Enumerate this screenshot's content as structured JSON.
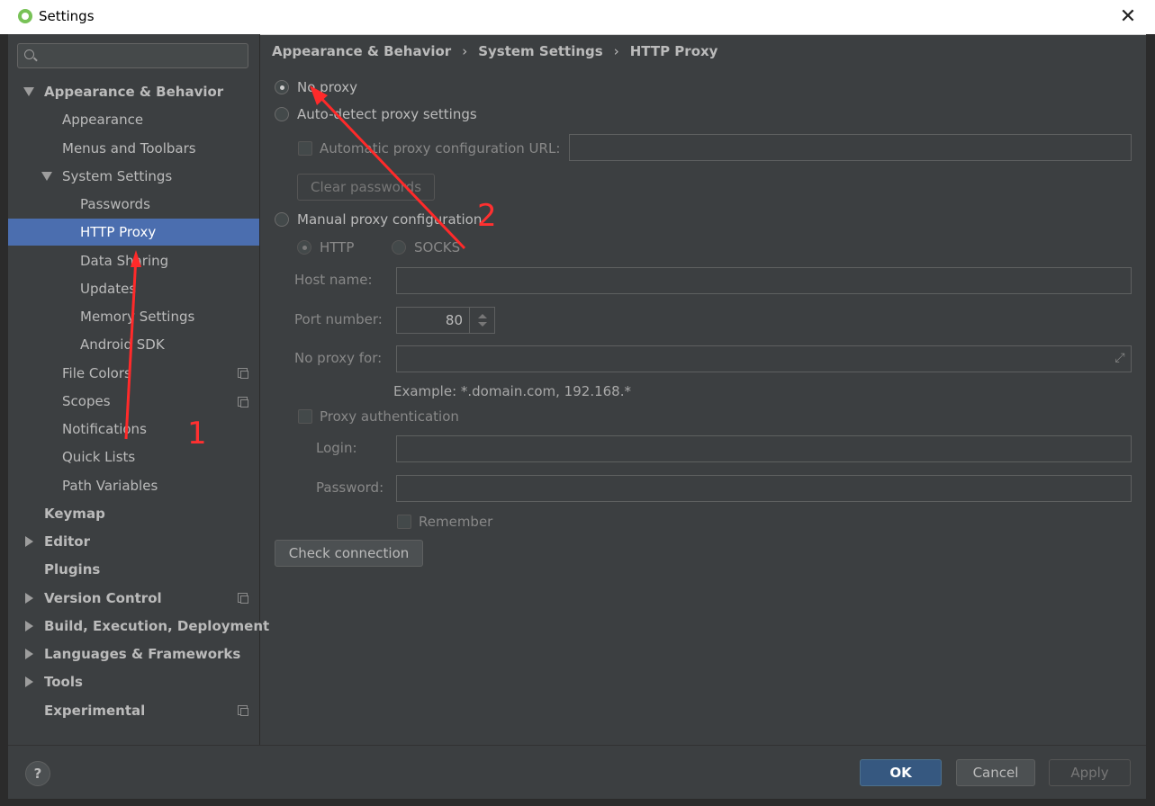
{
  "window": {
    "title": "Settings"
  },
  "search": {
    "placeholder": ""
  },
  "sidebar": {
    "items": [
      {
        "label": "Appearance & Behavior"
      },
      {
        "label": "Appearance"
      },
      {
        "label": "Menus and Toolbars"
      },
      {
        "label": "System Settings"
      },
      {
        "label": "Passwords"
      },
      {
        "label": "HTTP Proxy"
      },
      {
        "label": "Data Sharing"
      },
      {
        "label": "Updates"
      },
      {
        "label": "Memory Settings"
      },
      {
        "label": "Android SDK"
      },
      {
        "label": "File Colors"
      },
      {
        "label": "Scopes"
      },
      {
        "label": "Notifications"
      },
      {
        "label": "Quick Lists"
      },
      {
        "label": "Path Variables"
      },
      {
        "label": "Keymap"
      },
      {
        "label": "Editor"
      },
      {
        "label": "Plugins"
      },
      {
        "label": "Version Control"
      },
      {
        "label": "Build, Execution, Deployment"
      },
      {
        "label": "Languages & Frameworks"
      },
      {
        "label": "Tools"
      },
      {
        "label": "Experimental"
      }
    ],
    "selected": "HTTP Proxy"
  },
  "breadcrumb": [
    "Appearance & Behavior",
    "System Settings",
    "HTTP Proxy"
  ],
  "proxy": {
    "no_proxy": "No proxy",
    "auto_detect": "Auto-detect proxy settings",
    "auto_config_url": "Automatic proxy configuration URL:",
    "auto_config_url_value": "",
    "clear_passwords": "Clear passwords",
    "manual": "Manual proxy configuration",
    "http": "HTTP",
    "socks": "SOCKS",
    "host_label": "Host name:",
    "host_value": "",
    "port_label": "Port number:",
    "port_value": "80",
    "no_proxy_for_label": "No proxy for:",
    "no_proxy_for_value": "",
    "example": "Example: *.domain.com, 192.168.*",
    "proxy_auth": "Proxy authentication",
    "login_label": "Login:",
    "login_value": "",
    "password_label": "Password:",
    "password_value": "",
    "remember": "Remember",
    "check_connection": "Check connection",
    "selected_mode": "No proxy",
    "selected_protocol": "HTTP"
  },
  "footer": {
    "help": "?",
    "ok": "OK",
    "cancel": "Cancel",
    "apply": "Apply"
  },
  "annotations": {
    "one": "1",
    "two": "2"
  },
  "colors": {
    "accent": "#4b6eaf",
    "primary_button": "#365880",
    "annotation": "#ff3030",
    "background": "#3c3f41"
  }
}
